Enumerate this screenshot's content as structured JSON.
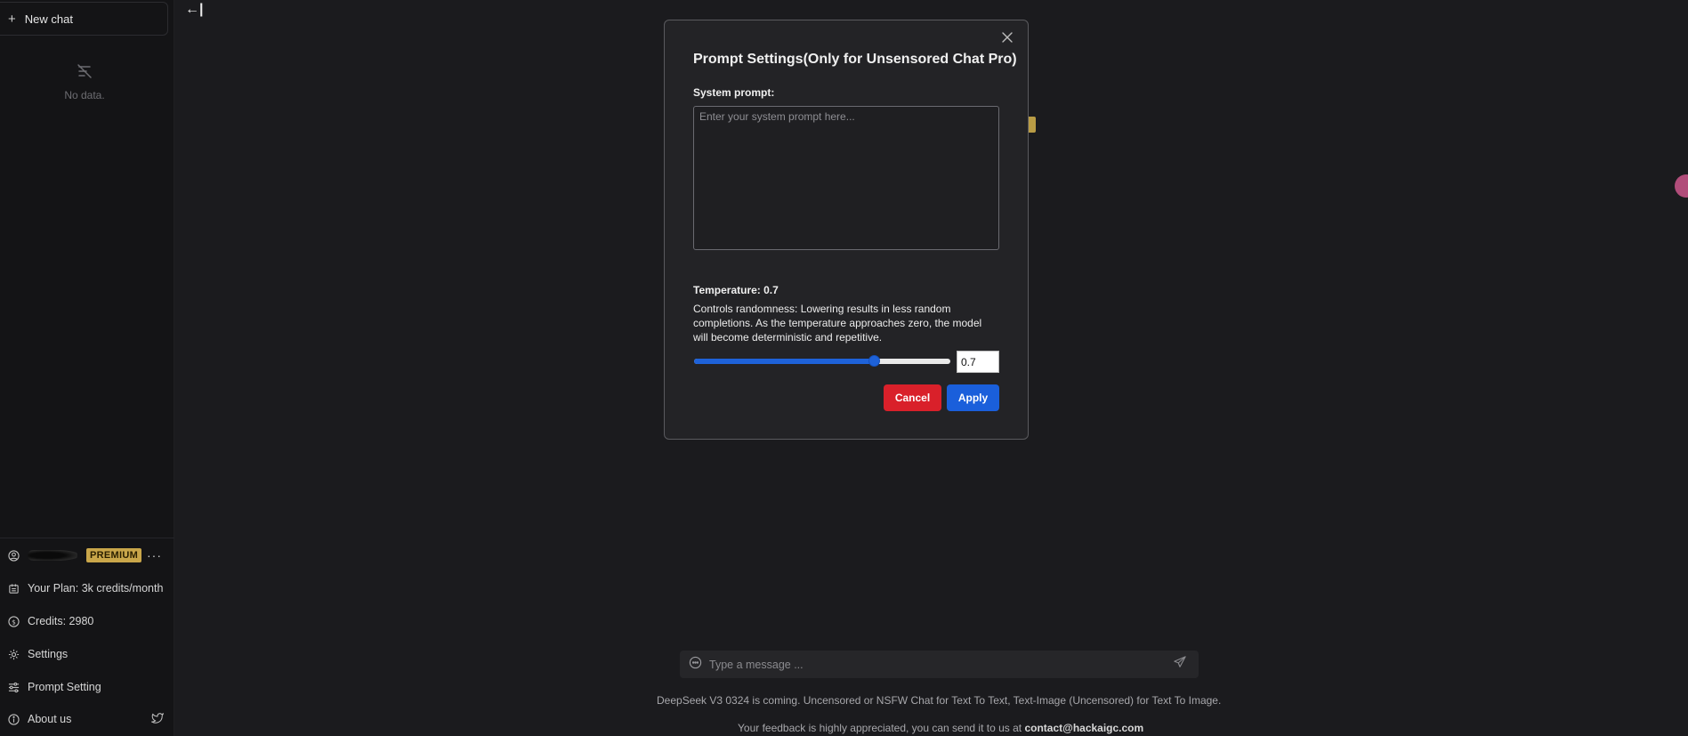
{
  "sidebar": {
    "new_chat_label": "New chat",
    "empty_text": "No data.",
    "account_badge": "PREMIUM",
    "plan_label": "Your Plan: 3k credits/month",
    "credits_label": "Credits: 2980",
    "settings_label": "Settings",
    "prompt_setting_label": "Prompt Setting",
    "about_label": "About us"
  },
  "main": {
    "collapse_glyph": "←|",
    "message_placeholder": "Type a message ...",
    "footer_line1": "DeepSeek V3 0324 is coming. Uncensored or NSFW Chat for Text To Text, Text-Image (Uncensored) for Text To Image.",
    "footer_line2_prefix": "Your feedback is highly appreciated, you can send it to us at ",
    "footer_email": "contact@hackaigc.com"
  },
  "modal": {
    "title": "Prompt Settings(Only for Unsensored Chat Pro)",
    "system_prompt_label": "System prompt:",
    "system_prompt_placeholder": "Enter your system prompt here...",
    "system_prompt_value": "",
    "temperature_label": "Temperature: 0.7",
    "temperature_description": "Controls randomness: Lowering results in less random completions. As the temperature approaches zero, the model will become deterministic and repetitive.",
    "temperature_value": "0.7",
    "temperature_fraction": 0.7,
    "cancel_label": "Cancel",
    "apply_label": "Apply"
  },
  "colors": {
    "accent_blue": "#1a5fdb",
    "cancel_red": "#d9202a",
    "premium_gold": "#c9a64a"
  }
}
